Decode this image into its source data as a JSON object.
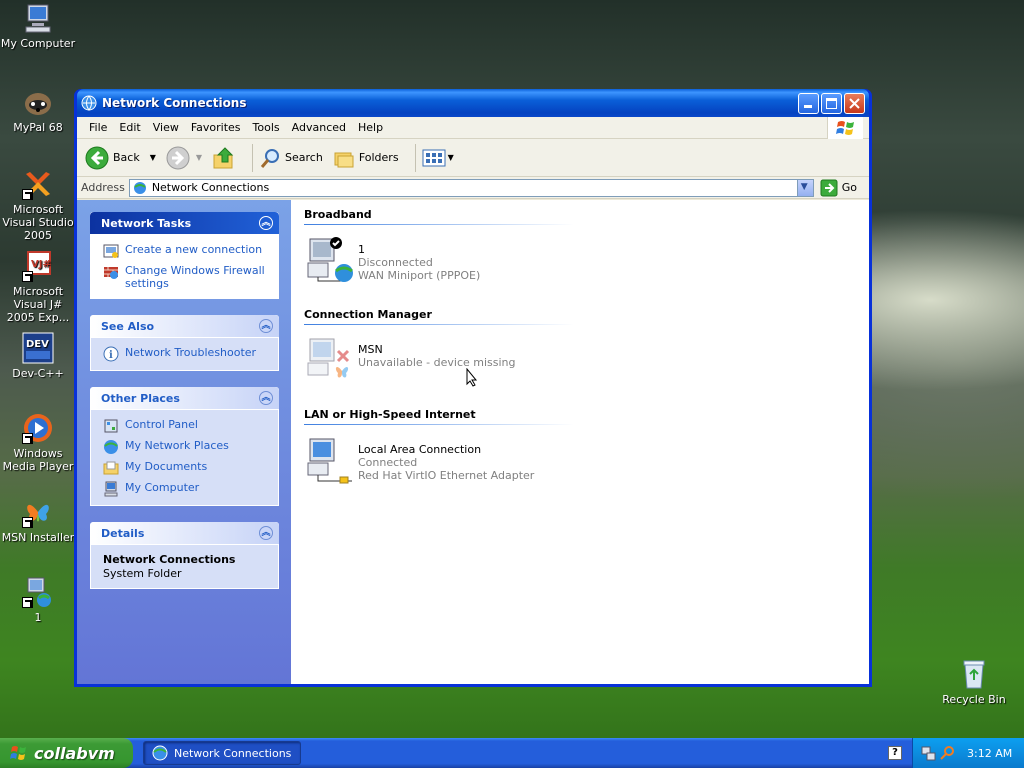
{
  "desktop": {
    "icons": [
      {
        "label": "My Computer"
      },
      {
        "label": "MyPal 68"
      },
      {
        "label": "Microsoft Visual Studio 2005"
      },
      {
        "label": "Microsoft Visual J# 2005 Exp..."
      },
      {
        "label": "Dev-C++"
      },
      {
        "label": "Windows Media Player"
      },
      {
        "label": "MSN Installer"
      },
      {
        "label": "1"
      },
      {
        "label": "Recycle Bin"
      }
    ]
  },
  "window": {
    "title": "Network Connections",
    "menu": [
      "File",
      "Edit",
      "View",
      "Favorites",
      "Tools",
      "Advanced",
      "Help"
    ],
    "toolbar": {
      "back_label": "Back",
      "search_label": "Search",
      "folders_label": "Folders"
    },
    "address": {
      "label": "Address",
      "value": "Network Connections",
      "go_label": "Go"
    },
    "left_pane": {
      "network_tasks": {
        "title": "Network Tasks",
        "items": [
          "Create a new connection",
          "Change Windows Firewall settings"
        ]
      },
      "see_also": {
        "title": "See Also",
        "items": [
          "Network Troubleshooter"
        ]
      },
      "other_places": {
        "title": "Other Places",
        "items": [
          "Control Panel",
          "My Network Places",
          "My Documents",
          "My Computer"
        ]
      },
      "details": {
        "title": "Details",
        "name": "Network Connections",
        "type": "System Folder"
      }
    },
    "groups": [
      {
        "title": "Broadband",
        "connection": {
          "name": "1",
          "status": "Disconnected",
          "device": "WAN Miniport (PPPOE)"
        }
      },
      {
        "title": "Connection Manager",
        "connection": {
          "name": "MSN",
          "status": "Unavailable - device missing"
        }
      },
      {
        "title": "LAN or High-Speed Internet",
        "connection": {
          "name": "Local Area Connection",
          "status": "Connected",
          "device": "Red Hat VirtIO Ethernet Adapter"
        }
      }
    ]
  },
  "taskbar": {
    "start_label": "collabvm",
    "task_button_label": "Network Connections",
    "clock": "3:12 AM"
  },
  "colors": {
    "xp_blue": "#0831d9",
    "task_link": "#215dc6",
    "left_pane_top": "#7ba2e7",
    "left_pane_bottom": "#6375d6",
    "start_green": "#3c9a35"
  }
}
